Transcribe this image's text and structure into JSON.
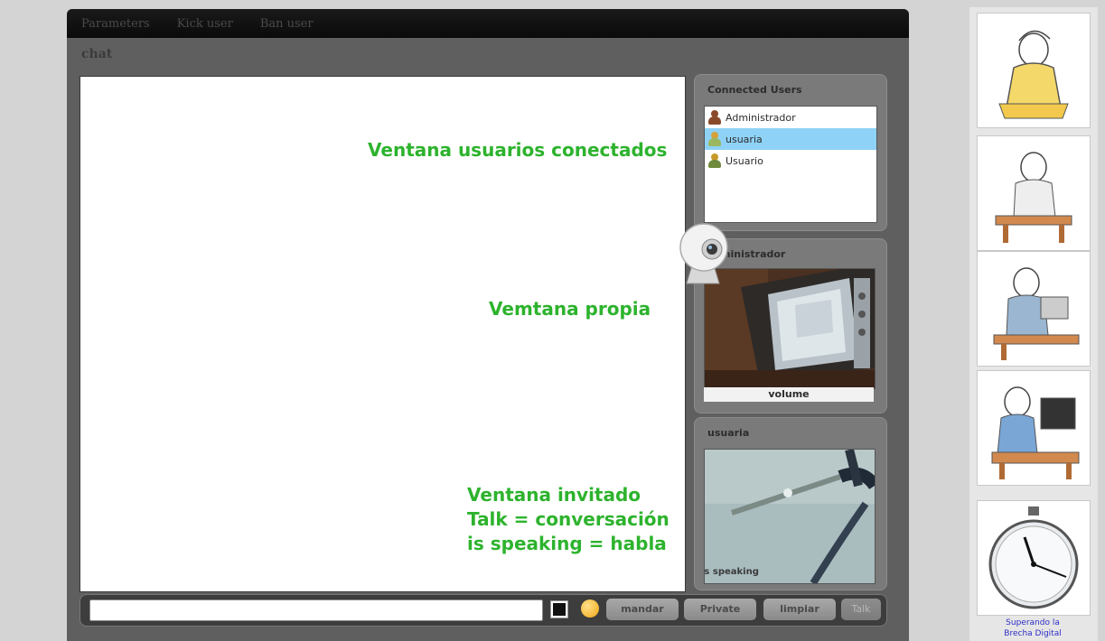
{
  "menu": {
    "items": [
      "Parameters",
      "Kick user",
      "Ban user"
    ]
  },
  "chat": {
    "label": "chat"
  },
  "annotations": {
    "users_window": "Ventana usuarios conectados",
    "own_window": "Vemtana propia",
    "guest_line1": "Ventana invitado",
    "guest_line2": "Talk = conversación",
    "guest_line3": "is speaking = habla"
  },
  "users_panel": {
    "title": "Connected Users",
    "users": [
      {
        "name": "Administrador",
        "selected": false,
        "icon": "admin-user-icon",
        "color": "#8a4a2a"
      },
      {
        "name": "usuaria",
        "selected": true,
        "icon": "user-icon",
        "color": "#d4a23a"
      },
      {
        "name": "Usuario",
        "selected": false,
        "icon": "user-icon",
        "color": "#c79a2a"
      }
    ]
  },
  "own_cam": {
    "title": "ministrador",
    "volume_label": "volume"
  },
  "guest_cam": {
    "title": "usuaria",
    "status": "is speaking"
  },
  "composer": {
    "input_value": "",
    "send_label": "mandar",
    "private_label": "Private",
    "clear_label": "limpiar",
    "talk_label": "Talk"
  },
  "sidebar": {
    "caption_line1": "Superando la",
    "caption_line2": "Brecha Digital"
  },
  "colors": {
    "annotation": "#2db32d",
    "selected_row": "#8fd2f7",
    "caption_link": "#2d2dc8"
  }
}
